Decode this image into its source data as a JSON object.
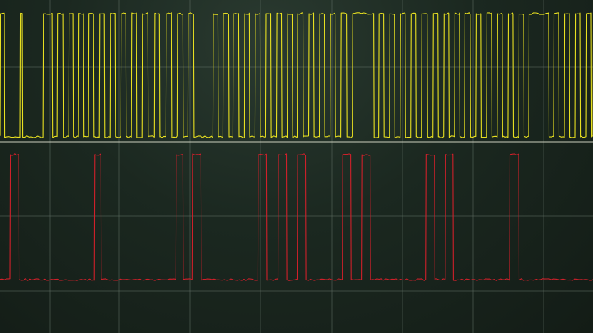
{
  "chart_data": {
    "type": "line",
    "title": "",
    "xlabel": "",
    "ylabel": "",
    "grid": true,
    "grid_divisions": {
      "x": 8,
      "y": 4
    },
    "colors": {
      "background": "#1b2820",
      "grid": "#5e6d62",
      "divider": "#d8dcc8"
    },
    "series": [
      {
        "color": "#e8e021",
        "low": 0,
        "high": 1,
        "edges": [
          0.0,
          0.6,
          2.8,
          3.1,
          6.0,
          7.3,
          8.0,
          8.8,
          9.6,
          10.2,
          11.0,
          11.7,
          12.4,
          13.1,
          13.9,
          14.6,
          15.4,
          16.1,
          16.9,
          17.6,
          18.4,
          19.1,
          19.9,
          20.7,
          21.6,
          22.3,
          23.2,
          24.0,
          24.8,
          25.6,
          26.3,
          27.1,
          29.8,
          30.5,
          31.2,
          32.0,
          32.6,
          33.4,
          34.2,
          34.9,
          35.7,
          36.4,
          37.2,
          37.9,
          38.7,
          39.4,
          40.2,
          40.9,
          41.6,
          42.4,
          43.2,
          43.9,
          44.7,
          45.4,
          46.2,
          46.9,
          47.7,
          48.5,
          49.3,
          52.3,
          53.0,
          53.7,
          54.5,
          55.2,
          56.0,
          56.7,
          57.5,
          58.2,
          59.0,
          59.8,
          60.6,
          61.3,
          62.1,
          62.8,
          63.6,
          64.3,
          65.0,
          65.8,
          66.6,
          67.3,
          68.1,
          68.8,
          69.6,
          70.3,
          71.1,
          71.8,
          72.6,
          73.3,
          74.0,
          76.8,
          77.5,
          78.2,
          79.0,
          79.7,
          80.5,
          81.2,
          82.0,
          82.7,
          83.0
        ]
      },
      {
        "color": "#d0202a",
        "low": 0,
        "high": 1,
        "edges": [
          1.4,
          2.6,
          13.2,
          14.1,
          24.6,
          25.6,
          26.9,
          28.1,
          36.1,
          37.3,
          38.9,
          40.1,
          41.6,
          42.8,
          47.9,
          49.1,
          50.6,
          51.8,
          59.6,
          60.8,
          62.3,
          63.4,
          71.3,
          72.6
        ]
      }
    ]
  }
}
